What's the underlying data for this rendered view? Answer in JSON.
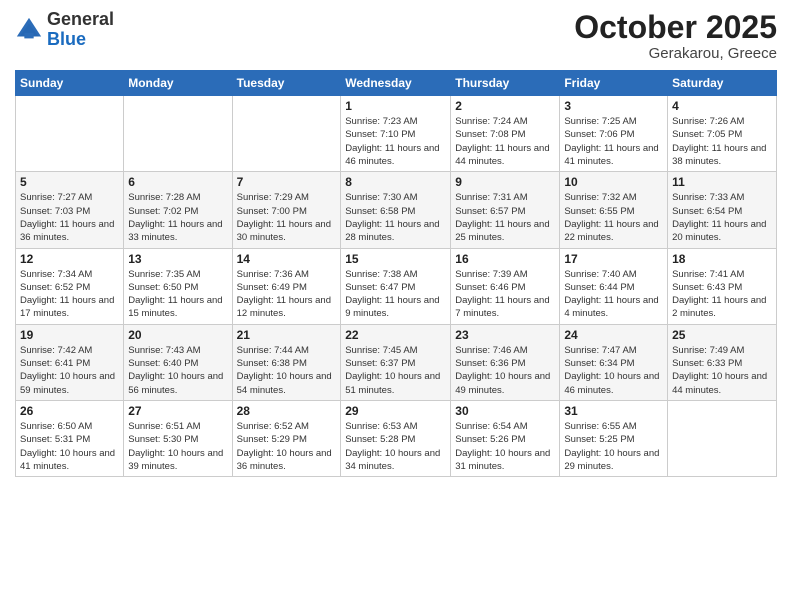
{
  "header": {
    "logo_general": "General",
    "logo_blue": "Blue",
    "month": "October 2025",
    "location": "Gerakarou, Greece"
  },
  "days_of_week": [
    "Sunday",
    "Monday",
    "Tuesday",
    "Wednesday",
    "Thursday",
    "Friday",
    "Saturday"
  ],
  "weeks": [
    [
      {
        "day": "",
        "info": ""
      },
      {
        "day": "",
        "info": ""
      },
      {
        "day": "",
        "info": ""
      },
      {
        "day": "1",
        "info": "Sunrise: 7:23 AM\nSunset: 7:10 PM\nDaylight: 11 hours and 46 minutes."
      },
      {
        "day": "2",
        "info": "Sunrise: 7:24 AM\nSunset: 7:08 PM\nDaylight: 11 hours and 44 minutes."
      },
      {
        "day": "3",
        "info": "Sunrise: 7:25 AM\nSunset: 7:06 PM\nDaylight: 11 hours and 41 minutes."
      },
      {
        "day": "4",
        "info": "Sunrise: 7:26 AM\nSunset: 7:05 PM\nDaylight: 11 hours and 38 minutes."
      }
    ],
    [
      {
        "day": "5",
        "info": "Sunrise: 7:27 AM\nSunset: 7:03 PM\nDaylight: 11 hours and 36 minutes."
      },
      {
        "day": "6",
        "info": "Sunrise: 7:28 AM\nSunset: 7:02 PM\nDaylight: 11 hours and 33 minutes."
      },
      {
        "day": "7",
        "info": "Sunrise: 7:29 AM\nSunset: 7:00 PM\nDaylight: 11 hours and 30 minutes."
      },
      {
        "day": "8",
        "info": "Sunrise: 7:30 AM\nSunset: 6:58 PM\nDaylight: 11 hours and 28 minutes."
      },
      {
        "day": "9",
        "info": "Sunrise: 7:31 AM\nSunset: 6:57 PM\nDaylight: 11 hours and 25 minutes."
      },
      {
        "day": "10",
        "info": "Sunrise: 7:32 AM\nSunset: 6:55 PM\nDaylight: 11 hours and 22 minutes."
      },
      {
        "day": "11",
        "info": "Sunrise: 7:33 AM\nSunset: 6:54 PM\nDaylight: 11 hours and 20 minutes."
      }
    ],
    [
      {
        "day": "12",
        "info": "Sunrise: 7:34 AM\nSunset: 6:52 PM\nDaylight: 11 hours and 17 minutes."
      },
      {
        "day": "13",
        "info": "Sunrise: 7:35 AM\nSunset: 6:50 PM\nDaylight: 11 hours and 15 minutes."
      },
      {
        "day": "14",
        "info": "Sunrise: 7:36 AM\nSunset: 6:49 PM\nDaylight: 11 hours and 12 minutes."
      },
      {
        "day": "15",
        "info": "Sunrise: 7:38 AM\nSunset: 6:47 PM\nDaylight: 11 hours and 9 minutes."
      },
      {
        "day": "16",
        "info": "Sunrise: 7:39 AM\nSunset: 6:46 PM\nDaylight: 11 hours and 7 minutes."
      },
      {
        "day": "17",
        "info": "Sunrise: 7:40 AM\nSunset: 6:44 PM\nDaylight: 11 hours and 4 minutes."
      },
      {
        "day": "18",
        "info": "Sunrise: 7:41 AM\nSunset: 6:43 PM\nDaylight: 11 hours and 2 minutes."
      }
    ],
    [
      {
        "day": "19",
        "info": "Sunrise: 7:42 AM\nSunset: 6:41 PM\nDaylight: 10 hours and 59 minutes."
      },
      {
        "day": "20",
        "info": "Sunrise: 7:43 AM\nSunset: 6:40 PM\nDaylight: 10 hours and 56 minutes."
      },
      {
        "day": "21",
        "info": "Sunrise: 7:44 AM\nSunset: 6:38 PM\nDaylight: 10 hours and 54 minutes."
      },
      {
        "day": "22",
        "info": "Sunrise: 7:45 AM\nSunset: 6:37 PM\nDaylight: 10 hours and 51 minutes."
      },
      {
        "day": "23",
        "info": "Sunrise: 7:46 AM\nSunset: 6:36 PM\nDaylight: 10 hours and 49 minutes."
      },
      {
        "day": "24",
        "info": "Sunrise: 7:47 AM\nSunset: 6:34 PM\nDaylight: 10 hours and 46 minutes."
      },
      {
        "day": "25",
        "info": "Sunrise: 7:49 AM\nSunset: 6:33 PM\nDaylight: 10 hours and 44 minutes."
      }
    ],
    [
      {
        "day": "26",
        "info": "Sunrise: 6:50 AM\nSunset: 5:31 PM\nDaylight: 10 hours and 41 minutes."
      },
      {
        "day": "27",
        "info": "Sunrise: 6:51 AM\nSunset: 5:30 PM\nDaylight: 10 hours and 39 minutes."
      },
      {
        "day": "28",
        "info": "Sunrise: 6:52 AM\nSunset: 5:29 PM\nDaylight: 10 hours and 36 minutes."
      },
      {
        "day": "29",
        "info": "Sunrise: 6:53 AM\nSunset: 5:28 PM\nDaylight: 10 hours and 34 minutes."
      },
      {
        "day": "30",
        "info": "Sunrise: 6:54 AM\nSunset: 5:26 PM\nDaylight: 10 hours and 31 minutes."
      },
      {
        "day": "31",
        "info": "Sunrise: 6:55 AM\nSunset: 5:25 PM\nDaylight: 10 hours and 29 minutes."
      },
      {
        "day": "",
        "info": ""
      }
    ]
  ]
}
